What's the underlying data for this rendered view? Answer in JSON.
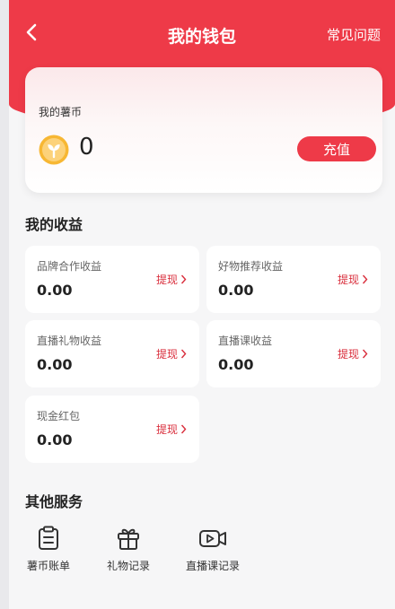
{
  "header": {
    "title": "我的钱包",
    "faq_label": "常见问题"
  },
  "wallet": {
    "label": "我的薯币",
    "balance": "0",
    "recharge_label": "充值"
  },
  "earnings": {
    "title": "我的收益",
    "withdraw_label": "提现",
    "items": [
      {
        "label": "品牌合作收益",
        "amount": "0.00"
      },
      {
        "label": "好物推荐收益",
        "amount": "0.00"
      },
      {
        "label": "直播礼物收益",
        "amount": "0.00"
      },
      {
        "label": "直播课收益",
        "amount": "0.00"
      },
      {
        "label": "现金红包",
        "amount": "0.00"
      }
    ]
  },
  "services": {
    "title": "其他服务",
    "items": [
      {
        "label": "薯币账单",
        "icon": "clipboard-icon"
      },
      {
        "label": "礼物记录",
        "icon": "gift-icon"
      },
      {
        "label": "直播课记录",
        "icon": "video-camera-icon"
      }
    ]
  },
  "colors": {
    "brand_red": "#ee3a48",
    "coin_gold": "#f7b733",
    "page_bg": "#f6f6f7"
  }
}
